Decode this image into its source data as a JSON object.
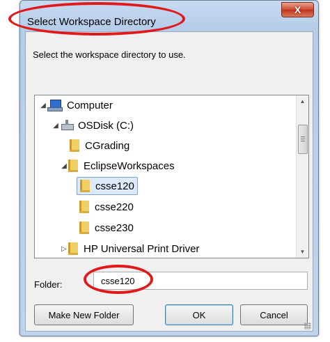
{
  "window": {
    "title": "Select Workspace Directory",
    "close_glyph": "X"
  },
  "instruction": "Select the workspace directory to use.",
  "tree": {
    "items": [
      {
        "label": "Computer",
        "expander": "expanded",
        "icon": "computer-icon"
      },
      {
        "label": "OSDisk (C:)",
        "expander": "expanded",
        "icon": "drive-icon"
      },
      {
        "label": "CGrading",
        "expander": "none",
        "icon": "folder-icon"
      },
      {
        "label": "EclipseWorkspaces",
        "expander": "expanded",
        "icon": "folder-icon"
      },
      {
        "label": "csse120",
        "expander": "none",
        "icon": "folder-icon",
        "selected": true
      },
      {
        "label": "csse220",
        "expander": "none",
        "icon": "folder-icon"
      },
      {
        "label": "csse230",
        "expander": "none",
        "icon": "folder-icon"
      },
      {
        "label": "HP Universal Print Driver",
        "expander": "collapsed",
        "icon": "folder-icon"
      }
    ]
  },
  "folder": {
    "label": "Folder:",
    "value": "csse120"
  },
  "buttons": {
    "make_new_folder": "Make New Folder",
    "ok": "OK",
    "cancel": "Cancel"
  },
  "colors": {
    "annotation_ring": "#e0191b",
    "selection": "#dceaf9"
  }
}
